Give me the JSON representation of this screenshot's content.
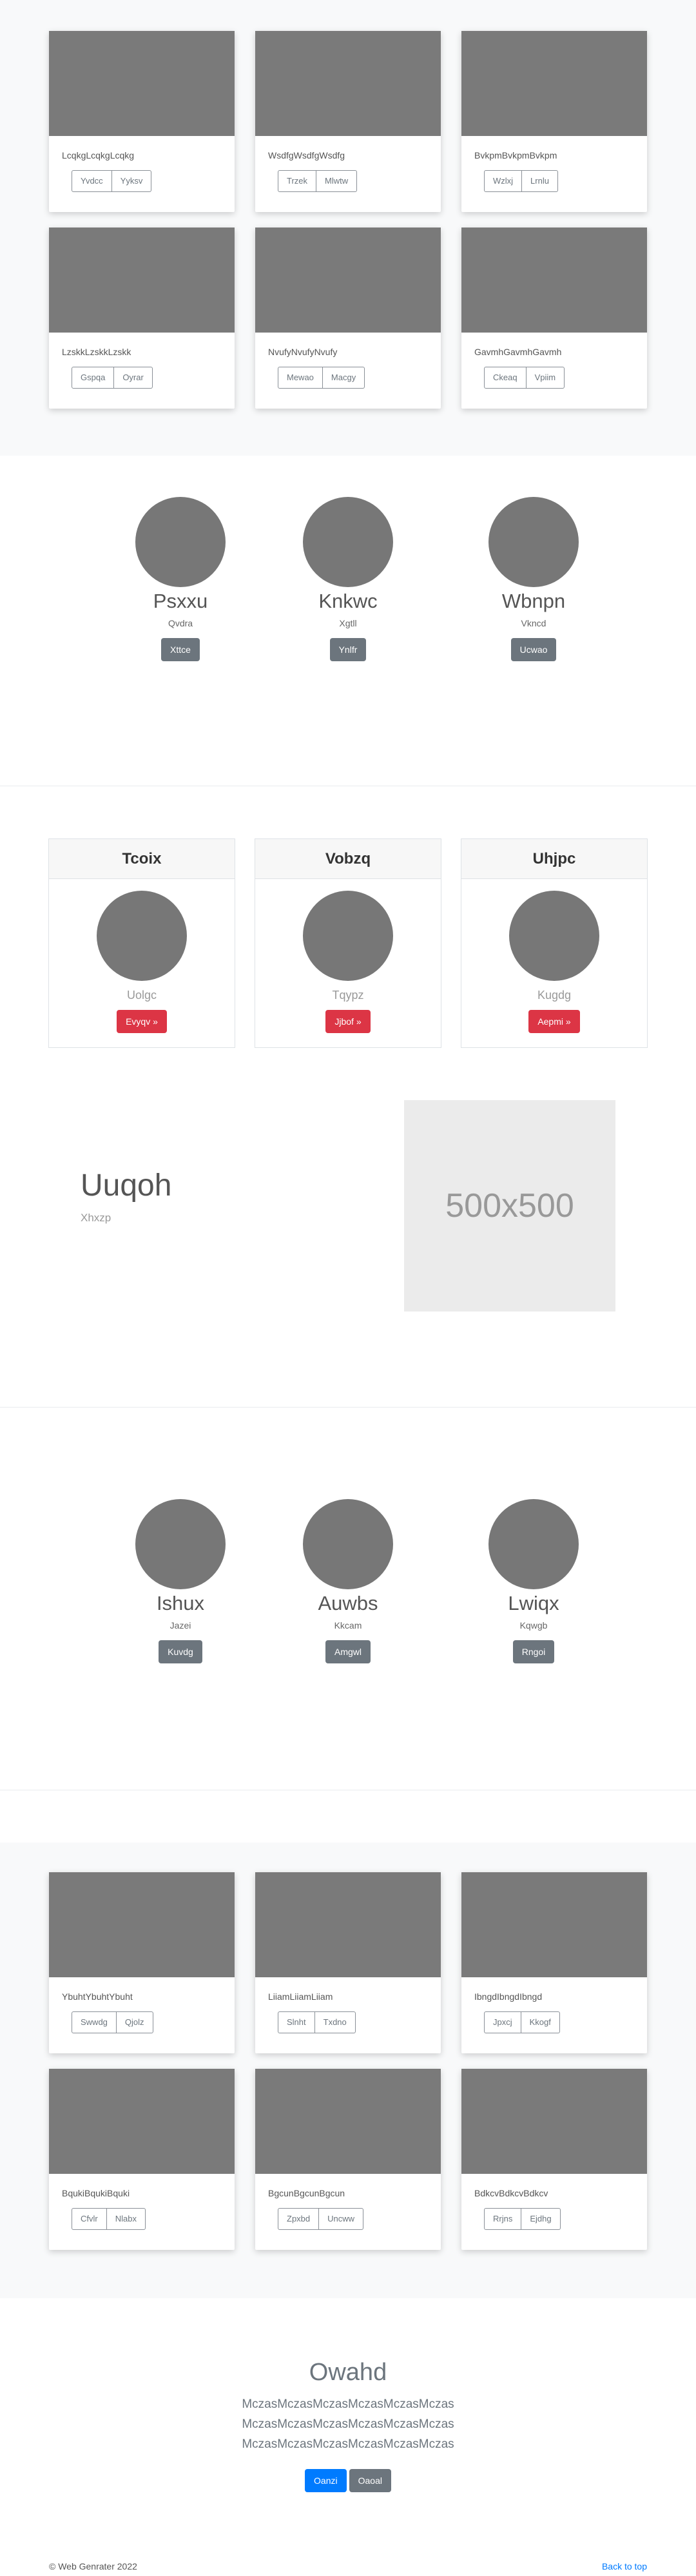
{
  "album_top": [
    {
      "text": "LcqkgLcqkgLcqkg",
      "buttons": [
        "Yvdcc",
        "Yyksv"
      ]
    },
    {
      "text": "WsdfgWsdfgWsdfg",
      "buttons": [
        "Trzek",
        "Mlwtw"
      ]
    },
    {
      "text": "BvkpmBvkpmBvkpm",
      "buttons": [
        "Wzlxj",
        "Lrnlu"
      ]
    },
    {
      "text": "LzskkLzskkLzskk",
      "buttons": [
        "Gspqa",
        "Oyrar"
      ]
    },
    {
      "text": "NvufyNvufyNvufy",
      "buttons": [
        "Mewao",
        "Macgy"
      ]
    },
    {
      "text": "GavmhGavmhGavmh",
      "buttons": [
        "Ckeaq",
        "Vpiim"
      ]
    }
  ],
  "profiles_1": [
    {
      "name": "Psxxu",
      "sub": "Qvdra",
      "button": "Xttce"
    },
    {
      "name": "Knkwc",
      "sub": "Xgtll",
      "button": "Ynlfr"
    },
    {
      "name": "Wbnpn",
      "sub": "Vkncd",
      "button": "Ucwao"
    }
  ],
  "team_cards": [
    {
      "header": "Tcoix",
      "sub": "Uolgc",
      "button": "Evyqv »"
    },
    {
      "header": "Vobzq",
      "sub": "Tqypz",
      "button": "Jjbof »"
    },
    {
      "header": "Uhjpc",
      "sub": "Kugdg",
      "button": "Aepmi »"
    }
  ],
  "feature": {
    "title": "Uuqoh",
    "sub": "Xhxzp",
    "placeholder": "500x500"
  },
  "profiles_2": [
    {
      "name": "Ishux",
      "sub": "Jazei",
      "button": "Kuvdg"
    },
    {
      "name": "Auwbs",
      "sub": "Kkcam",
      "button": "Amgwl"
    },
    {
      "name": "Lwiqx",
      "sub": "Kqwgb",
      "button": "Rngoi"
    }
  ],
  "album_bottom": [
    {
      "text": "YbuhtYbuhtYbuht",
      "buttons": [
        "Swwdg",
        "Qjolz"
      ]
    },
    {
      "text": "LiiamLiiamLiiam",
      "buttons": [
        "Slnht",
        "Txdno"
      ]
    },
    {
      "text": "IbngdIbngdIbngd",
      "buttons": [
        "Jpxcj",
        "Kkogf"
      ]
    },
    {
      "text": "BqukiBqukiBquki",
      "buttons": [
        "Cfvlr",
        "Nlabx"
      ]
    },
    {
      "text": "BgcunBgcunBgcun",
      "buttons": [
        "Zpxbd",
        "Uncww"
      ]
    },
    {
      "text": "BdkcvBdkcvBdkcv",
      "buttons": [
        "Rrjns",
        "Ejdhg"
      ]
    }
  ],
  "closing": {
    "title": "Owahd",
    "lines": [
      "MczasMczasMczasMczasMczasMczas",
      "MczasMczasMczasMczasMczasMczas",
      "MczasMczasMczasMczasMczasMczas"
    ],
    "primary": "Oanzi",
    "secondary": "Oaoal"
  },
  "footer": {
    "copyright": "© Web Genrater 2022",
    "back_to_top": "Back to top"
  }
}
